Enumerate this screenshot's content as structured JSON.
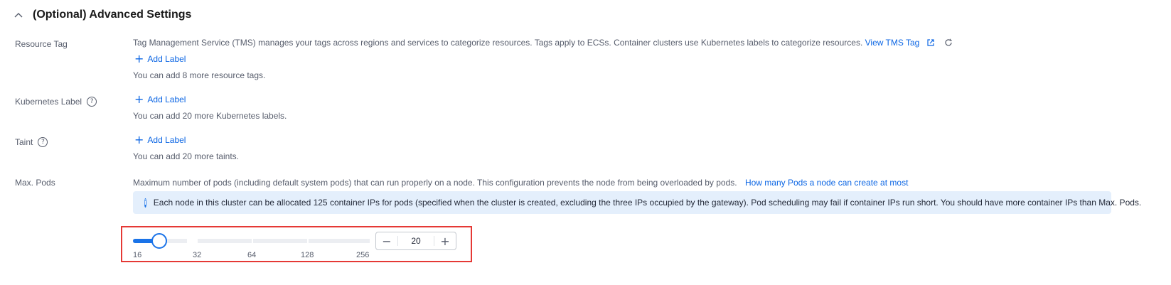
{
  "section": {
    "title": "(Optional) Advanced Settings"
  },
  "resource_tag": {
    "label": "Resource Tag",
    "description": "Tag Management Service (TMS) manages your tags across regions and services to categorize resources. Tags apply to ECSs. Container clusters use Kubernetes labels to categorize resources.",
    "link": "View TMS Tag",
    "add_label": "Add Label",
    "hint": "You can add 8 more resource tags."
  },
  "kubernetes_label": {
    "label": "Kubernetes Label",
    "add_label": "Add Label",
    "hint": "You can add 20 more Kubernetes labels."
  },
  "taint": {
    "label": "Taint",
    "add_label": "Add Label",
    "hint": "You can add 20 more taints."
  },
  "max_pods": {
    "label": "Max. Pods",
    "description": "Maximum number of pods (including default system pods) that can run properly on a node. This configuration prevents the node from being overloaded by pods.",
    "link": "How many Pods a node can create at most",
    "info": "Each node in this cluster can be allocated 125 container IPs for pods (specified when the cluster is created, excluding the three IPs occupied by the gateway). Pod scheduling may fail if container IPs run short. You should have more container IPs than Max. Pods.",
    "slider_ticks": [
      "16",
      "32",
      "64",
      "128",
      "256"
    ],
    "value": "20",
    "minus": "−",
    "plus": "+"
  },
  "icons": {
    "collapse": "chevron-up-icon",
    "help": "question-circle-icon",
    "external_link": "external-link-icon",
    "refresh": "refresh-icon",
    "add": "plus-icon",
    "info": "info-circle-icon"
  },
  "colors": {
    "accent": "#1a73e8",
    "link": "#0c66e4",
    "banner_bg": "#e4effc",
    "highlight": "#e53935"
  }
}
